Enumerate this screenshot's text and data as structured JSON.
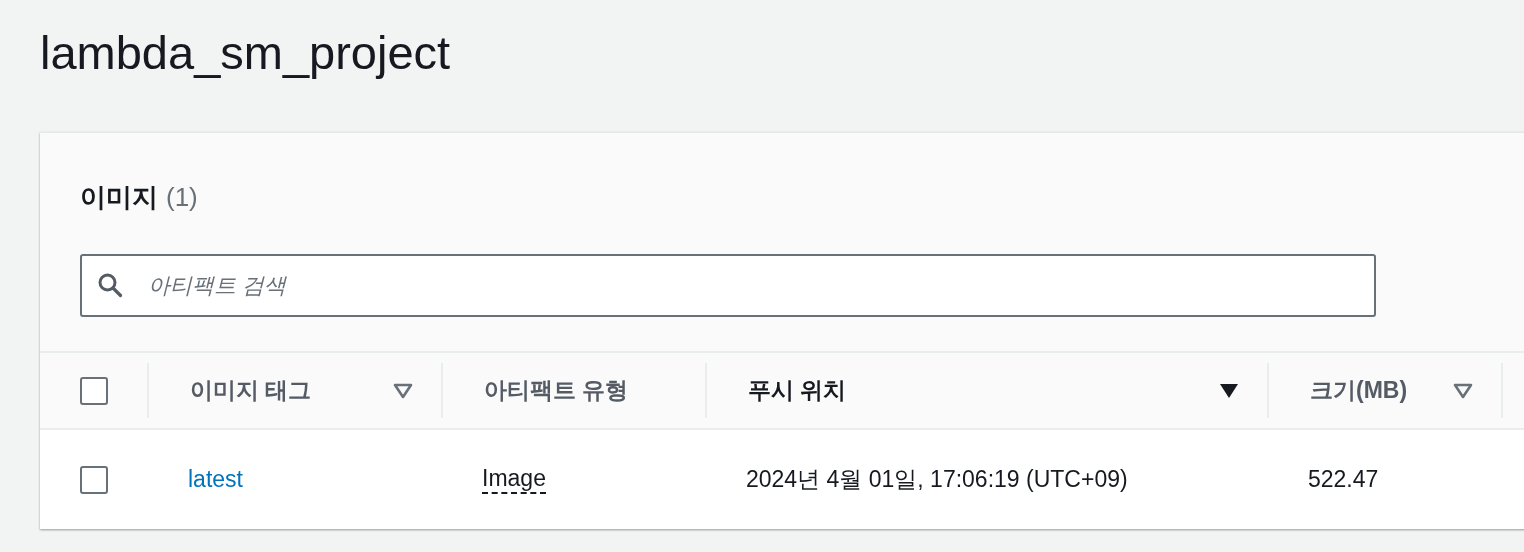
{
  "page_title": "lambda_sm_project",
  "panel": {
    "heading": "이미지",
    "count": "(1)",
    "search": {
      "placeholder": "아티팩트 검색"
    },
    "table": {
      "select_all": {
        "checked": false
      },
      "columns": [
        {
          "label": "이미지 태그",
          "sortable": true,
          "sorted": false
        },
        {
          "label": "아티팩트 유형",
          "sortable": false,
          "sorted": false
        },
        {
          "label": "푸시 위치",
          "sortable": true,
          "sorted": true
        },
        {
          "label": "크기(MB)",
          "sortable": true,
          "sorted": false
        }
      ],
      "rows": [
        {
          "selected": false,
          "image_tag": "latest",
          "artifact_type": "Image",
          "pushed_at": "2024년 4월 01일, 17:06:19 (UTC+09)",
          "size": "522.47"
        }
      ]
    }
  }
}
